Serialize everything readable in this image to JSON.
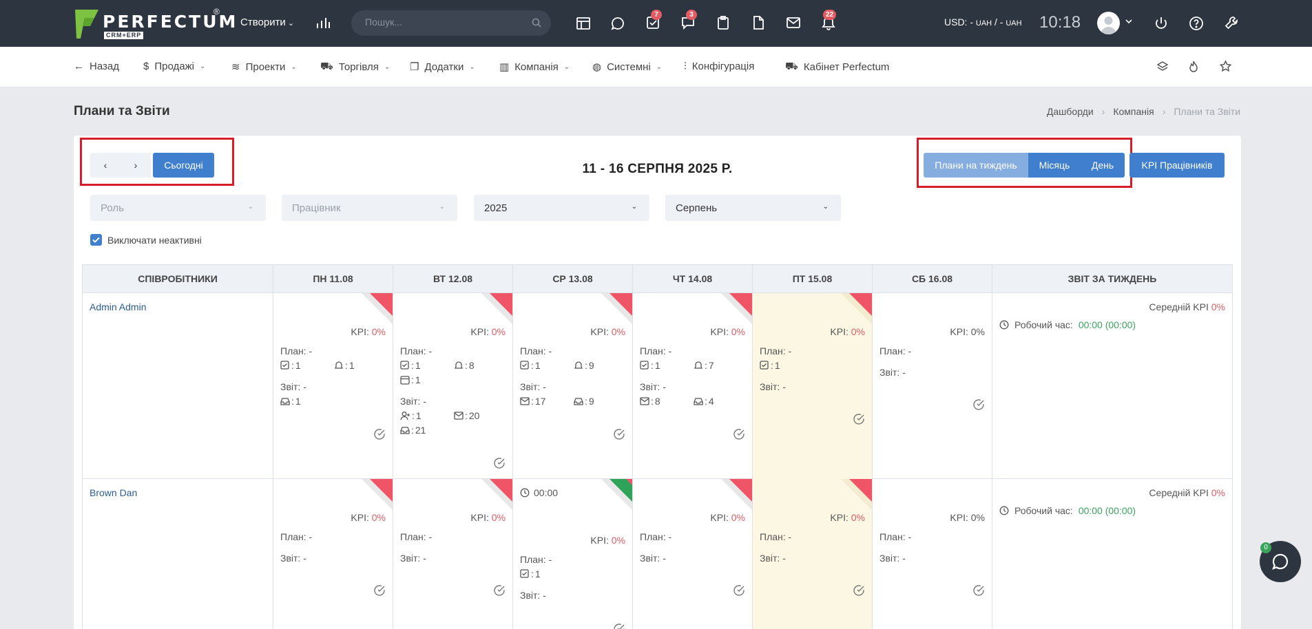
{
  "topbar": {
    "brand": "PERFECTUM",
    "brand_sub": "CRM+ERP",
    "brand_reg": "®",
    "create_label": "Створити",
    "search_placeholder": "Пошук...",
    "badges": {
      "tasks": "7",
      "chat": "3",
      "notifications": "22"
    },
    "currency_label": "USD: - ",
    "currency_unit1": "UAH",
    "currency_sep": " / - ",
    "currency_unit2": "UAH",
    "time": "10:18"
  },
  "nav": {
    "back": "Назад",
    "sales": "Продажі",
    "projects": "Проекти",
    "trade": "Торгівля",
    "addons": "Додатки",
    "company": "Компанія",
    "system": "Системні",
    "config": "Конфігурація",
    "cabinet": "Кабінет Perfectum"
  },
  "page": {
    "title": "Плани та Звіти",
    "breadcrumbs": [
      "Дашборди",
      "Компанія",
      "Плани та Звіти"
    ]
  },
  "toolbar": {
    "prev": "‹",
    "next": "›",
    "today": "Сьогодні",
    "week_title": "11 - 16 СЕРПНЯ 2025 Р.",
    "view_week": "Плани на тиждень",
    "view_month": "Місяць",
    "view_day": "День",
    "kpi_button": "KPI Працівників"
  },
  "filters": {
    "role_placeholder": "Роль",
    "employee_placeholder": "Працівник",
    "year": "2025",
    "month": "Серпень",
    "exclude_inactive": "Виключати неактивні"
  },
  "table": {
    "headers": [
      "СПІВРОБІТНИКИ",
      "ПН 11.08",
      "ВТ 12.08",
      "СР 13.08",
      "ЧТ 14.08",
      "ПТ 15.08",
      "СБ 16.08",
      "ЗВІТ ЗА ТИЖДЕНЬ"
    ],
    "labels": {
      "kpi": "KPI: ",
      "plan": "План: -",
      "report": "Звіт: -",
      "avg_kpi": "Середній KPI ",
      "work_time": "Робочий час:",
      "work_time_value": "00:00 (00:00)"
    },
    "rows": [
      {
        "employee": "Admin Admin",
        "avg_kpi": "0%",
        "days": [
          {
            "kpi": "0%",
            "tasks": "1",
            "reminders": "1",
            "report_inbox": "1"
          },
          {
            "kpi": "0%",
            "tasks": "1",
            "reminders": "8",
            "events": "1",
            "report_contacts": "1",
            "report_mail": "20",
            "report_inbox": "21"
          },
          {
            "kpi": "0%",
            "tasks": "1",
            "reminders": "9",
            "report_mail": "17",
            "report_inbox": "9"
          },
          {
            "kpi": "0%",
            "tasks": "1",
            "reminders": "7",
            "report_mail": "8",
            "report_inbox": "4"
          },
          {
            "kpi": "0%",
            "tasks": "1"
          },
          {
            "kpi": "0%"
          }
        ]
      },
      {
        "employee": "Brown Dan",
        "avg_kpi": "0%",
        "days": [
          {
            "kpi": "0%"
          },
          {
            "kpi": "0%"
          },
          {
            "kpi": "0%",
            "time": "00:00",
            "tasks": "1"
          },
          {
            "kpi": "0%"
          },
          {
            "kpi": "0%"
          },
          {
            "kpi": "0%"
          }
        ]
      }
    ]
  },
  "chat": {
    "badge": "0"
  },
  "colors": {
    "topbar": "#2d3540",
    "accent": "#3f7fce",
    "danger": "#e35b63",
    "success": "#3aa45d",
    "today": "#fcf7e3"
  }
}
